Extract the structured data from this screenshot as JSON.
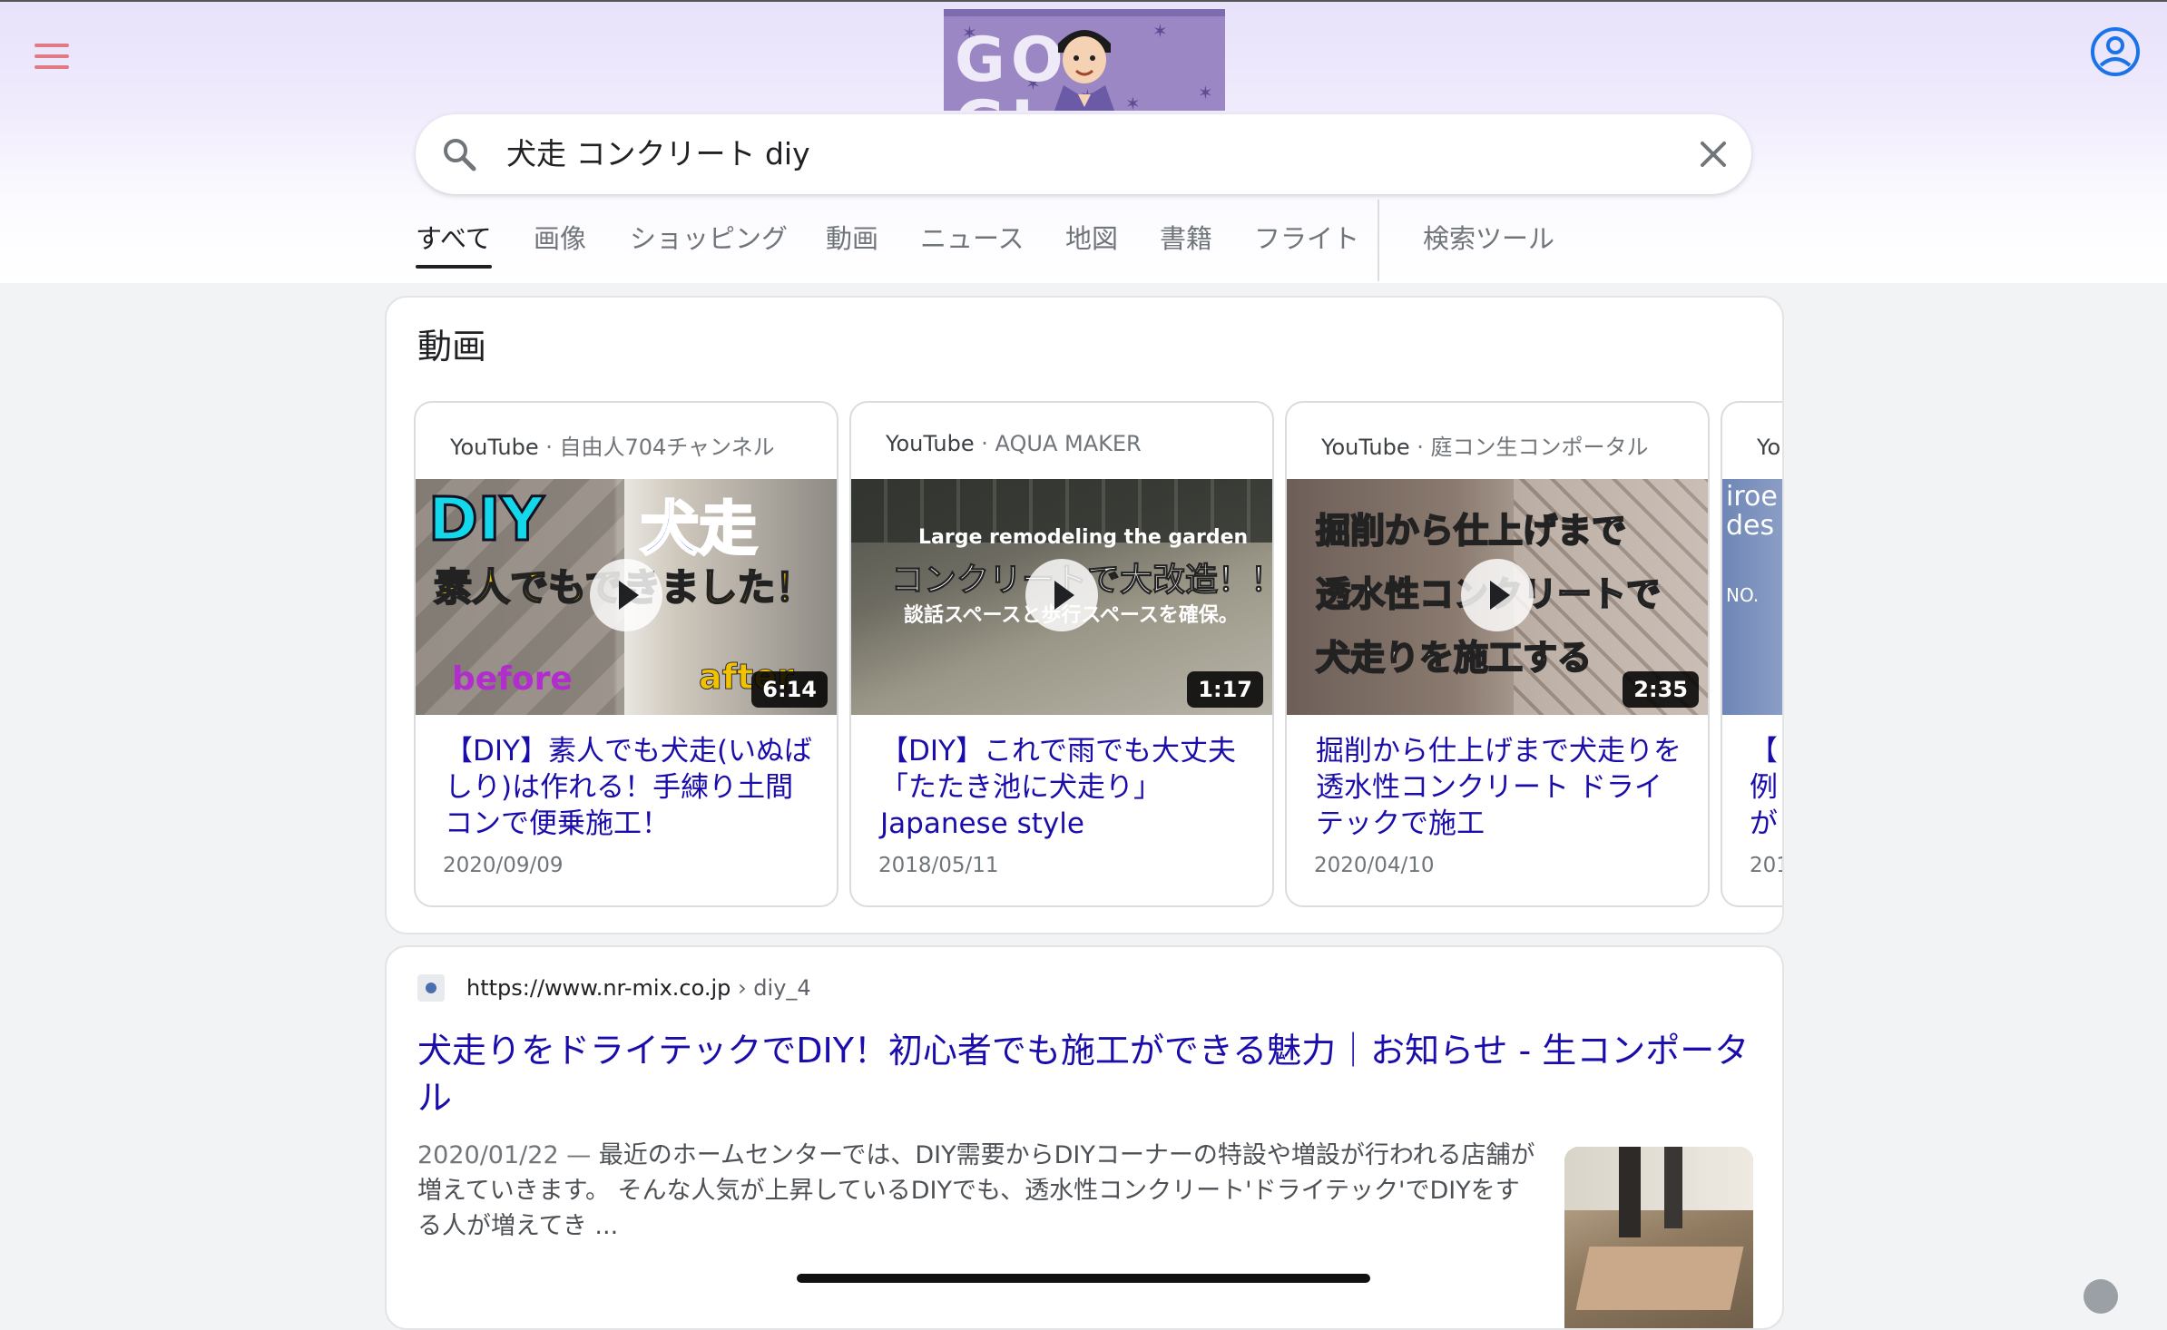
{
  "header": {
    "doodle_text": "GOOGLE",
    "search_query": "犬走 コンクリート diy"
  },
  "tabs": [
    {
      "label": "すべて",
      "active": true
    },
    {
      "label": "画像"
    },
    {
      "label": "ショッピング"
    },
    {
      "label": "動画"
    },
    {
      "label": "ニュース"
    },
    {
      "label": "地図"
    },
    {
      "label": "書籍"
    },
    {
      "label": "フライト"
    },
    {
      "label": "検索ツール"
    }
  ],
  "videos": {
    "section_title": "動画",
    "items": [
      {
        "source": "YouTube",
        "channel": "自由人704チャンネル",
        "title": "【DIY】素人でも犬走(いぬばしり)は作れる！手練り土間コンで便乗施工！",
        "date": "2020/09/09",
        "duration": "6:14",
        "thumb_lines": [
          "DIY",
          "犬走",
          "素人でもできました！",
          "before",
          "after"
        ]
      },
      {
        "source": "YouTube",
        "channel": "AQUA MAKER",
        "title": "【DIY】これで雨でも大丈夫「たたき池に犬走り」Japanese style",
        "date": "2018/05/11",
        "duration": "1:17",
        "thumb_lines": [
          "Large remodeling the garden",
          "コンクリートで大改造！！",
          "談話スペースと歩行スペースを確保。"
        ]
      },
      {
        "source": "YouTube",
        "channel": "庭コン生コンポータル",
        "title": "掘削から仕上げまで犬走りを透水性コンクリート ドライテックで施工",
        "date": "2020/04/10",
        "duration": "2:35",
        "thumb_lines": [
          "掘削から仕上げまで",
          "透水性コンクリートで",
          "犬走りを施工する"
        ]
      },
      {
        "source": "Yo",
        "title_lines": [
          "【",
          "例",
          "が"
        ],
        "date": "201",
        "thumb_lines": [
          "iroe",
          "des",
          "NO."
        ]
      }
    ]
  },
  "result": {
    "url": "https://www.nr-mix.co.jp",
    "breadcrumb": "› diy_4",
    "title": "犬走りをドライテックでDIY！初心者でも施工ができる魅力｜お知らせ - 生コンポータル",
    "date": "2020/01/22",
    "snippet": "最近のホームセンターでは、DIY需要からDIYコーナーの特設や増設が行われる店舗が増えていきます。 そんな人気が上昇しているDIYでも、透水性コンクリート'ドライテック'でDIYをする人が増えてき ..."
  },
  "icons": {
    "menu": "hamburger-menu-icon",
    "account": "account-circle-icon",
    "search": "search-icon",
    "clear": "close-icon",
    "play": "play-icon"
  },
  "colors": {
    "link": "#1a0dab",
    "menu_icon": "#e07b86",
    "account_icon": "#1a73e8",
    "doodle_bg": "#9a87c4"
  }
}
